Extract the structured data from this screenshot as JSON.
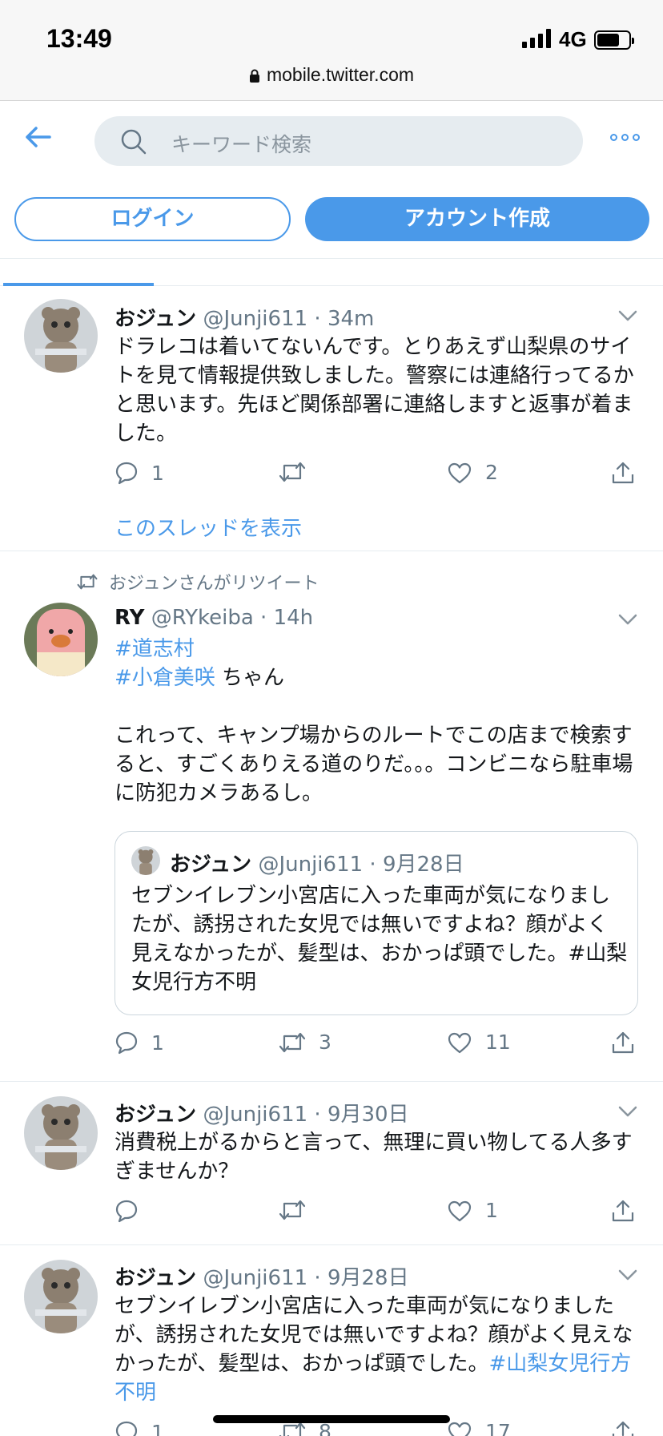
{
  "status_bar": {
    "time": "13:49",
    "network": "4G",
    "url": "mobile.twitter.com"
  },
  "header": {
    "search_placeholder": "キーワード検索",
    "login_label": "ログイン",
    "signup_label": "アカウント作成"
  },
  "tweets": [
    {
      "name": "おジュン",
      "handle": "@Junji611",
      "time": "34m",
      "text": "ドラレコは着いてないんです。とりあえず山梨県のサイトを見て情報提供致しました。警察には連絡行ってるかと思います。先ほど関係部署に連絡しますと返事が着ました。",
      "replies": "1",
      "retweets": "",
      "likes": "2",
      "show_thread": "このスレッドを表示"
    },
    {
      "retweet_label": "おジュンさんがリツイート",
      "name": "RY",
      "handle": "@RYkeiba",
      "time": "14h",
      "hashtag1": "#道志村",
      "hashtag2": "#小倉美咲",
      "hashtag2_suffix": " ちゃん",
      "body": "これって、キャンプ場からのルートでこの店まで検索すると、すごくありえる道のりだ。。。コンビニなら駐車場に防犯カメラあるし。",
      "quote": {
        "name": "おジュン",
        "handle": "@Junji611",
        "time": "9月28日",
        "text": "セブンイレブン小宮店に入った車両が気になりましたが、誘拐された女児では無いですよね？顔がよく見えなかったが、髪型は、おかっぱ頭でした。#山梨女児行方不明"
      },
      "replies": "1",
      "retweets": "3",
      "likes": "11"
    },
    {
      "name": "おジュン",
      "handle": "@Junji611",
      "time": "9月30日",
      "text": "消費税上がるからと言って、無理に買い物してる人多すぎませんか？",
      "replies": "",
      "retweets": "",
      "likes": "1"
    },
    {
      "name": "おジュン",
      "handle": "@Junji611",
      "time": "9月28日",
      "text": "セブンイレブン小宮店に入った車両が気になりましたが、誘拐された女児では無いですよね？顔がよく見えなかったが、髪型は、おかっぱ頭でした。",
      "hashtag": "#山梨女児行方不明",
      "replies": "1",
      "retweets": "8",
      "likes": "17"
    }
  ],
  "colors": {
    "accent": "#4a99e9",
    "muted": "#657786",
    "text": "#14171a"
  },
  "icons": [
    "back-arrow-icon",
    "search-icon",
    "more-icon",
    "reply-icon",
    "retweet-icon",
    "like-icon",
    "share-icon",
    "chevron-down-icon",
    "lock-icon"
  ]
}
